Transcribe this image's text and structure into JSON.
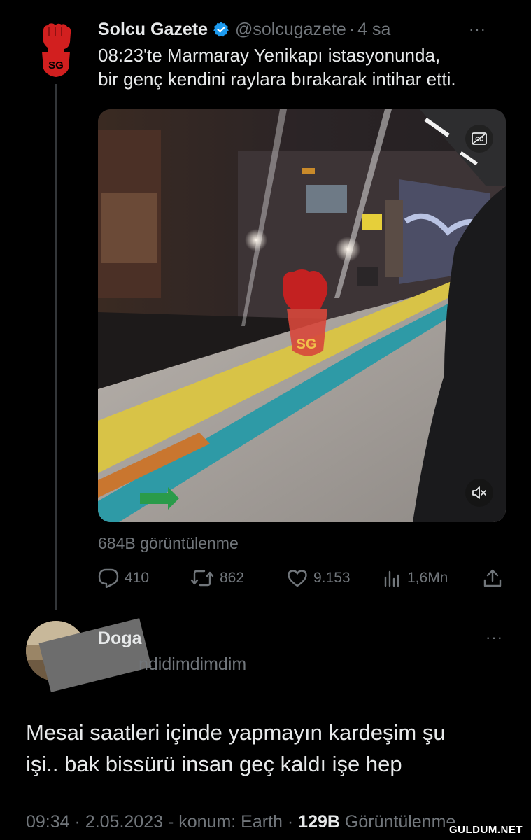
{
  "original_tweet": {
    "name": "Solcu Gazete",
    "handle": "@solcugazete",
    "separator": "·",
    "time": "4 sa",
    "more_label": "···",
    "avatar_text": "SG",
    "text_line1": "08:23'te Marmaray Yenikapı istasyonunda,",
    "text_line2": "bir genç kendini raylara bırakarak intihar etti.",
    "views": "684B görüntülenme",
    "video_logo_text": "SG",
    "metrics": {
      "replies": "410",
      "retweets": "862",
      "likes": "9.153",
      "impressions": "1,6Mn"
    }
  },
  "reply": {
    "name": "Doga",
    "handle_visible": "ndidimdimdim",
    "more_label": "···",
    "text_line1": "Mesai saatleri içinde yapmayın kardeşim şu",
    "text_line2": "işi.. bak bissürü insan geç kaldı işe hep",
    "meta_time": "09:34",
    "meta_date": "2.05.2023",
    "meta_location": "konum: Earth",
    "meta_views_count": "129B",
    "meta_views_label": "Görüntülenme",
    "separator": "·"
  },
  "watermark": "GULDUM.NET",
  "colors": {
    "background": "#000000",
    "text_primary": "#e7e9ea",
    "text_secondary": "#71767b",
    "verified_blue": "#1d9bf0",
    "logo_red": "#d21f1f"
  },
  "icons": [
    "reply-icon",
    "retweet-icon",
    "like-icon",
    "analytics-icon",
    "share-icon",
    "verified-badge-icon",
    "captions-icon",
    "mute-icon",
    "more-icon"
  ]
}
